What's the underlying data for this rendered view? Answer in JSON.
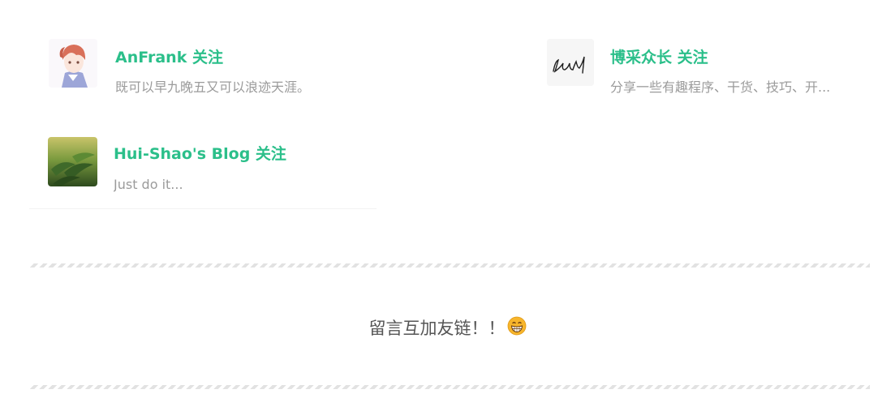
{
  "friends": [
    {
      "name": "AnFrank 关注",
      "description": "既可以早九晚五又可以浪迹天涯。",
      "avatar_icon": "anime-boy-avatar"
    },
    {
      "name": "博采众长 关注",
      "description": "分享一些有趣程序、干货、技巧、开...",
      "avatar_icon": "signature-avatar"
    },
    {
      "name": "Hui-Shao's Blog 关注",
      "description": "Just do it...",
      "avatar_icon": "green-leaves-avatar"
    }
  ],
  "message": {
    "text": "留言互加友链！！",
    "emoji_icon": "grinning-face-icon"
  },
  "colors": {
    "accent": "#2bbf8a",
    "muted_text": "#9b9b9b",
    "divider": "#e2e2e2"
  }
}
